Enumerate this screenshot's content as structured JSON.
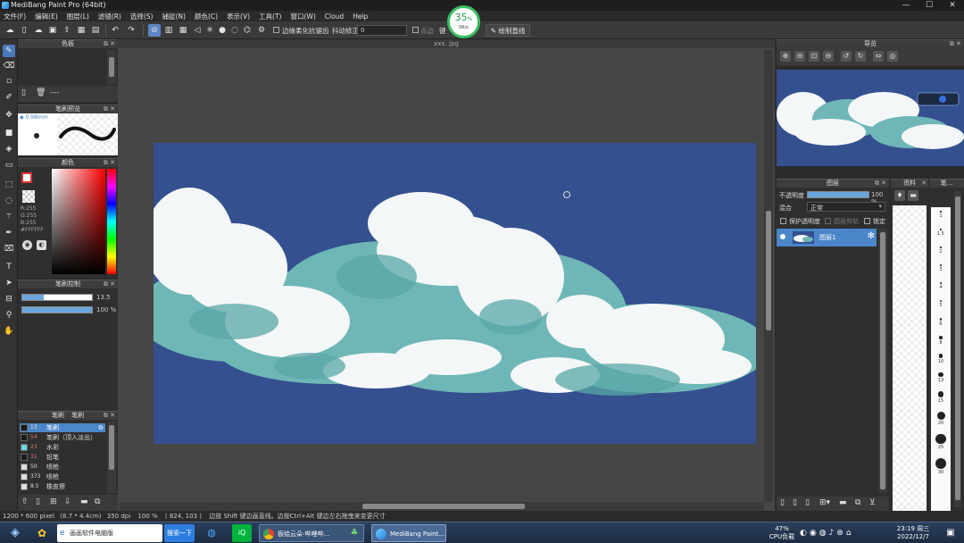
{
  "window": {
    "title": "MediBang Paint Pro (64bit)",
    "controls": {
      "minimize": "—",
      "maximize": "☐",
      "close": "✕"
    }
  },
  "menu": [
    "文件(F)",
    "编辑(E)",
    "图层(L)",
    "滤镜(R)",
    "选择(S)",
    "捕捉(N)",
    "颜色(C)",
    "表示(V)",
    "工具(T)",
    "窗口(W)",
    "Cloud",
    "Help"
  ],
  "toolbar": {
    "antialias_label": "边缘柔化抗锯齿",
    "stabilizer_label": "抖动修正",
    "stabilizer_value": "0",
    "correction_label": "点边",
    "key_label": "键",
    "draw_line_label": "绘制直线"
  },
  "cpu_widget": {
    "percent": "35",
    "unit": "%",
    "speed": "0K/s"
  },
  "canvas": {
    "file_tab": "xxx. jpg"
  },
  "panels": {
    "palette": {
      "title": "色板",
      "value": "----"
    },
    "brush_shape": {
      "title": "笔刷预览",
      "size": "0.98mm"
    },
    "color": {
      "title": "颜色",
      "r": "R:255",
      "g": "G:255",
      "b": "B:255",
      "hex": "#FFFFFF"
    },
    "brush_control": {
      "title": "笔刷控制",
      "size": "13.5",
      "opacity": "100",
      "opacity_unit": "%"
    },
    "brush_list": {
      "title": "笔刷",
      "title2": "笔刷",
      "items": [
        {
          "size": "13",
          "name": "笔刷",
          "selected": true
        },
        {
          "size": "54",
          "name": "笔刷（顶入淡出）",
          "selected": false
        },
        {
          "size": "23",
          "name": "水彩",
          "selected": false
        },
        {
          "size": "31",
          "name": "铅笔",
          "selected": false
        },
        {
          "size": "50",
          "name": "喷枪",
          "selected": false
        },
        {
          "size": "373",
          "name": "喷枪",
          "selected": false
        },
        {
          "size": "8.5",
          "name": "橡皮擦",
          "selected": false
        }
      ]
    },
    "navigator": {
      "title": "导览"
    },
    "layers": {
      "title": "图层",
      "opacity_label": "不透明度",
      "opacity_value": "100",
      "opacity_unit": "%",
      "blend_label": "混合",
      "blend_value": "正常",
      "protect_alpha": "保护透明度",
      "clipping": "图层剪贴",
      "lock": "锁定",
      "layer_name": "图层1"
    },
    "materials": {
      "title": "资料"
    },
    "brush_sizes": {
      "title": "笔...",
      "sizes": [
        "1",
        "1.5",
        "2",
        "3",
        "4",
        "5",
        "6",
        "8",
        "10",
        "13",
        "15",
        "20",
        "25",
        "30"
      ]
    }
  },
  "status": {
    "dimensions": "1200 * 600 pixel",
    "physical": "(8.7 * 4.4cm)",
    "dpi": "350 dpi",
    "zoom": "100 %",
    "cursor": "( 824, 103 )",
    "hint": "边放 Shift 键边画直线。边按Ctrl+Alt 键边左右拖曳来变更尺寸"
  },
  "taskbar": {
    "search_value": "画画软件电脑版",
    "search_button": "搜索一下",
    "items": [
      "板绘云朵-哔哩哔...",
      "MediBang Paint..."
    ],
    "cpu_pct": "47%",
    "cpu_label": "CPU负载",
    "time": "23:19 周三",
    "date": "2022/12/7"
  },
  "colors": {
    "sky": "#34508f",
    "cloud_teal": "#6fb7b6",
    "cloud_white": "#f4f7f8",
    "accent": "#4a86c8"
  }
}
